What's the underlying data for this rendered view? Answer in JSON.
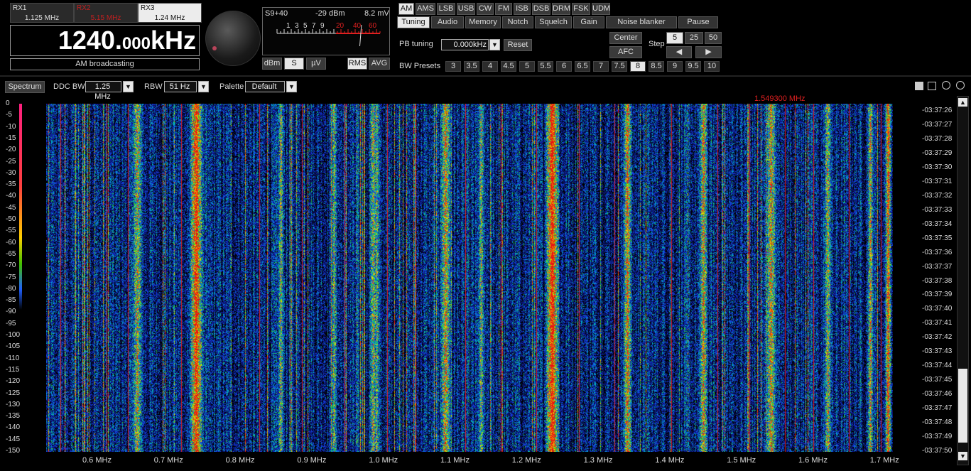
{
  "receivers": [
    {
      "name": "RX1",
      "freq": "1.125 MHz"
    },
    {
      "name": "RX2",
      "freq": "5.15 MHz"
    },
    {
      "name": "RX3",
      "freq": "1.24 MHz"
    }
  ],
  "frequency": {
    "main": "1240.",
    "small": "000",
    "unit": "kHz"
  },
  "band_label": "AM broadcasting",
  "meter": {
    "s_label": "S9+40",
    "dbm": "-29 dBm",
    "mv": "8.2 mV",
    "scale": [
      "1",
      "3",
      "5",
      "7",
      "9",
      "20",
      "40",
      "60"
    ],
    "buttons": [
      "dBm",
      "S",
      "µV",
      "RMS",
      "AVG"
    ],
    "needle_fraction": 0.82
  },
  "modes": [
    "AM",
    "AMS",
    "LSB",
    "USB",
    "CW",
    "FM",
    "ISB",
    "DSB",
    "DRM",
    "FSK",
    "UDM"
  ],
  "tabs": [
    "Tuning",
    "Audio",
    "Memory",
    "Notch",
    "Squelch",
    "Gain",
    "Noise blanker",
    "Pause"
  ],
  "tuning": {
    "pb_label": "PB tuning",
    "pb_value": "0.000kHz",
    "reset": "Reset",
    "center": "Center",
    "afc": "AFC",
    "step_label": "Step",
    "steps": [
      "5",
      "25",
      "50"
    ],
    "left_arrow": "◀",
    "right_arrow": "▶",
    "bw_label": "BW Presets",
    "bw_presets": [
      "3",
      "3.5",
      "4",
      "4.5",
      "5",
      "5.5",
      "6",
      "6.5",
      "7",
      "7.5",
      "8",
      "8.5",
      "9",
      "9.5",
      "10"
    ]
  },
  "spectrum_bar": {
    "spectrum": "Spectrum",
    "ddc_label": "DDC BW",
    "ddc_value": "1.25 MHz",
    "rbw_label": "RBW",
    "rbw_value": "51 Hz",
    "palette_label": "Palette",
    "palette_value": "Default",
    "marker_freq": "1.549300 MHz"
  },
  "y_axis": [
    "0",
    "-5",
    "-10",
    "-15",
    "-20",
    "-25",
    "-30",
    "-35",
    "-40",
    "-45",
    "-50",
    "-55",
    "-60",
    "-65",
    "-70",
    "-75",
    "-80",
    "-85",
    "-90",
    "-95",
    "-100",
    "-105",
    "-110",
    "-115",
    "-120",
    "-125",
    "-130",
    "-135",
    "-140",
    "-145",
    "-150"
  ],
  "time_axis": [
    "-03:37:26",
    "-03:37:27",
    "-03:37:28",
    "-03:37:29",
    "-03:37:30",
    "-03:37:31",
    "-03:37:32",
    "-03:37:33",
    "-03:37:34",
    "-03:37:35",
    "-03:37:36",
    "-03:37:37",
    "-03:37:38",
    "-03:37:39",
    "-03:37:40",
    "-03:37:41",
    "-03:37:42",
    "-03:37:43",
    "-03:37:44",
    "-03:37:45",
    "-03:37:46",
    "-03:37:47",
    "-03:37:48",
    "-03:37:49",
    "-03:37:50"
  ],
  "x_axis": [
    "0.6 MHz",
    "0.7 MHz",
    "0.8 MHz",
    "0.9 MHz",
    "1.0 MHz",
    "1.1 MHz",
    "1.2 MHz",
    "1.3 MHz",
    "1.4 MHz",
    "1.5 MHz",
    "1.6 MHz",
    "1.7 MHz"
  ],
  "colors": {
    "accent": "#e02020",
    "panel": "#3a3a3a",
    "active": "#e8e8e8"
  }
}
